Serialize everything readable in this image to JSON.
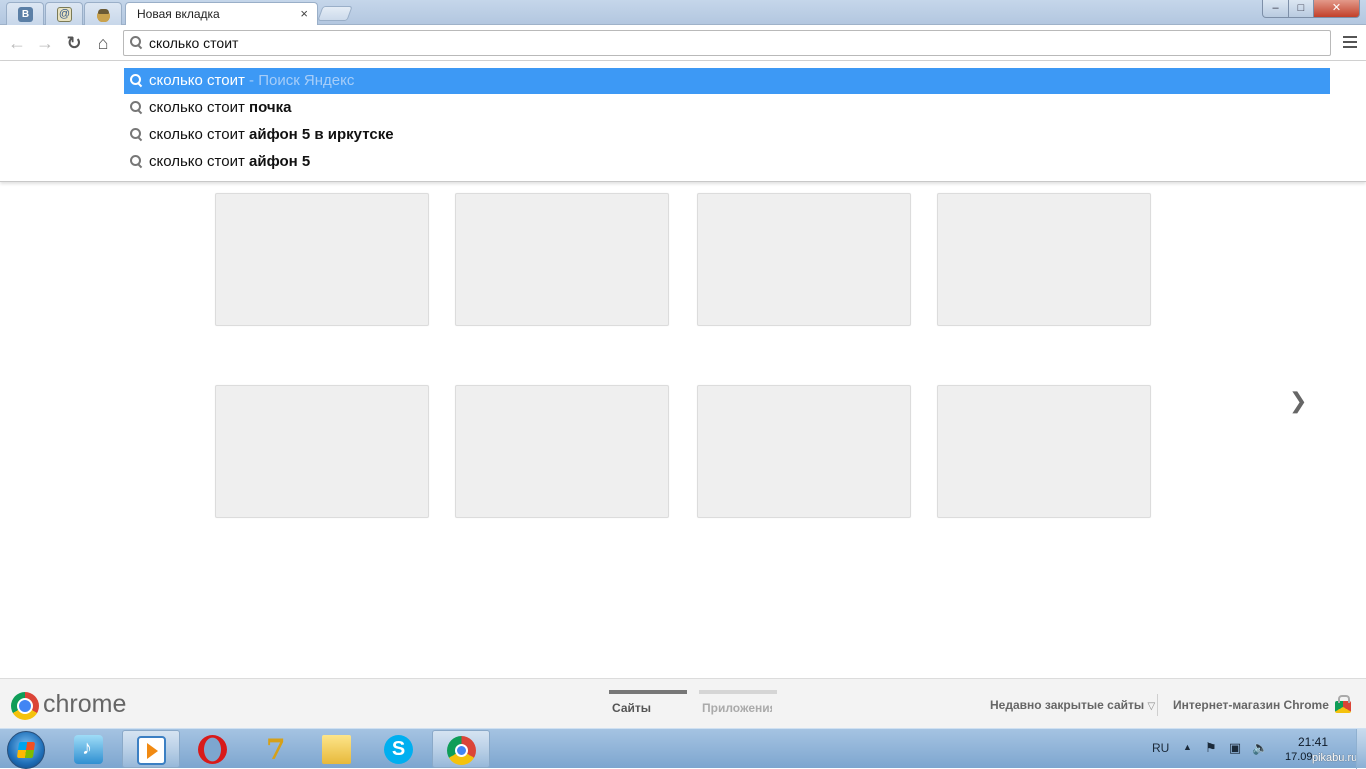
{
  "tabs": {
    "pinned": [
      {
        "name": "vk-tab",
        "glyph": "B"
      },
      {
        "name": "mail-tab",
        "glyph": "@"
      },
      {
        "name": "acorn-tab",
        "glyph": ""
      }
    ],
    "active_title": "Новая вкладка",
    "close_glyph": "×"
  },
  "window_controls": {
    "minimize": "–",
    "maximize": "□",
    "close": "✕"
  },
  "toolbar": {
    "back_glyph": "←",
    "forward_glyph": "→",
    "reload_glyph": "↻",
    "home_glyph": "⌂"
  },
  "omnibox": {
    "value": "сколько стоит "
  },
  "suggestions": [
    {
      "prefix": "сколько стоит",
      "bold": "",
      "hint": " - Поиск Яндекс",
      "selected": true
    },
    {
      "prefix": "сколько стоит ",
      "bold": "почка",
      "hint": "",
      "selected": false
    },
    {
      "prefix": "сколько стоит ",
      "bold": "айфон 5 в иркутске",
      "hint": "",
      "selected": false
    },
    {
      "prefix": "сколько стоит ",
      "bold": "айфон 5",
      "hint": "",
      "selected": false
    }
  ],
  "ntp": {
    "next_page_glyph": "❯",
    "brand": "chrome",
    "pager": {
      "sites": "Сайты",
      "apps": "Приложения"
    },
    "recently_closed": "Недавно закрытые сайты",
    "recently_closed_arrow": "▽",
    "web_store": "Интернет-магазин Chrome"
  },
  "taskbar": {
    "apps": [
      "music-player",
      "media-player",
      "opera",
      "7-zip",
      "file-manager",
      "skype",
      "chrome"
    ],
    "skype_glyph": "S",
    "tray": {
      "lang": "RU",
      "up_arrow": "▲",
      "flag": "⚑",
      "net": "▣",
      "vol": "🔈"
    },
    "clock_time": "21:41",
    "clock_date": "17.09.",
    "watermark": "pikabu.ru"
  },
  "colors": {
    "selection": "#3d99f5",
    "tab_strip": "#c5d6ea",
    "taskbar": "#8fb4da"
  }
}
